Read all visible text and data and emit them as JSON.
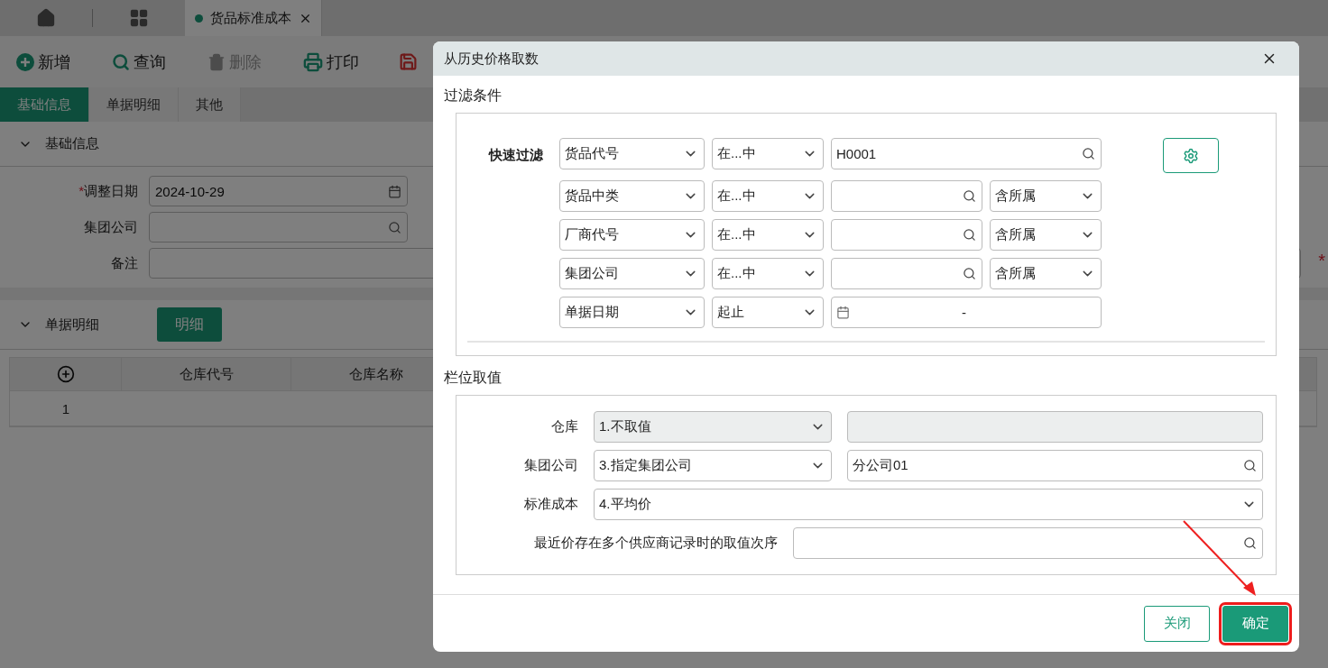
{
  "app_tabs": [
    {
      "kind": "home",
      "selected": false
    },
    {
      "kind": "grid",
      "selected": false
    },
    {
      "kind": "doc",
      "label": "货品标准成本",
      "selected": true
    }
  ],
  "toolbar": [
    {
      "kind": "add",
      "label": "新增",
      "disabled": false
    },
    {
      "kind": "search",
      "label": "查询",
      "disabled": false
    },
    {
      "kind": "delete",
      "label": "删除",
      "disabled": true
    },
    {
      "kind": "print",
      "label": "打印",
      "disabled": false
    },
    {
      "kind": "save",
      "disabled": false
    }
  ],
  "page_tabs": [
    {
      "label": "基础信息",
      "selected": true
    },
    {
      "label": "单据明细",
      "selected": false
    },
    {
      "label": "其他",
      "selected": false
    }
  ],
  "basic_section": {
    "title": "基础信息",
    "expanded": true,
    "fields": [
      {
        "label": "调整日期",
        "required_mark": "*",
        "value": "2024-10-29",
        "kind": "date"
      },
      {
        "label": "集团公司",
        "kind": "lookup"
      },
      {
        "label": "备注",
        "kind": "wide"
      }
    ],
    "edge_mark": "*"
  },
  "detail_section": {
    "title": "单据明细",
    "expanded": true,
    "button": "明细",
    "columns": [
      "仓库代号",
      "仓库名称"
    ],
    "rows": [
      {
        "index": "1"
      }
    ]
  },
  "dialog": {
    "title": "从历史价格取数",
    "filter_title": "过滤条件",
    "quick_filter_label": "快速过滤",
    "filters": [
      {
        "field": "货品代号",
        "operator": "在...中",
        "kind": "lookup",
        "value": "H0001"
      },
      {
        "field": "货品中类",
        "operator": "在...中",
        "kind": "lookup_scope",
        "scope": "含所属"
      },
      {
        "field": "厂商代号",
        "operator": "在...中",
        "kind": "lookup_scope",
        "scope": "含所属"
      },
      {
        "field": "集团公司",
        "operator": "在...中",
        "kind": "lookup_scope",
        "scope": "含所属"
      },
      {
        "field": "单据日期",
        "operator": "起止",
        "kind": "date_range",
        "separator": "-"
      }
    ],
    "value_title": "栏位取值",
    "value_rows": [
      {
        "label": "仓库",
        "kind": "select_field",
        "select": "1.不取值",
        "disabled": true
      },
      {
        "label": "集团公司",
        "kind": "select_field",
        "select": "3.指定集团公司",
        "value": "分公司01",
        "disabled": false
      },
      {
        "label": "标准成本",
        "kind": "select",
        "select": "4.平均价",
        "disabled": false
      },
      {
        "label": "最近价存在多个供应商记录时的取值次序",
        "kind": "field",
        "disabled": false
      }
    ],
    "buttons": [
      {
        "label": "关闭",
        "kind": "secondary",
        "highlighted": false
      },
      {
        "label": "确定",
        "kind": "primary",
        "highlighted": true
      }
    ]
  }
}
